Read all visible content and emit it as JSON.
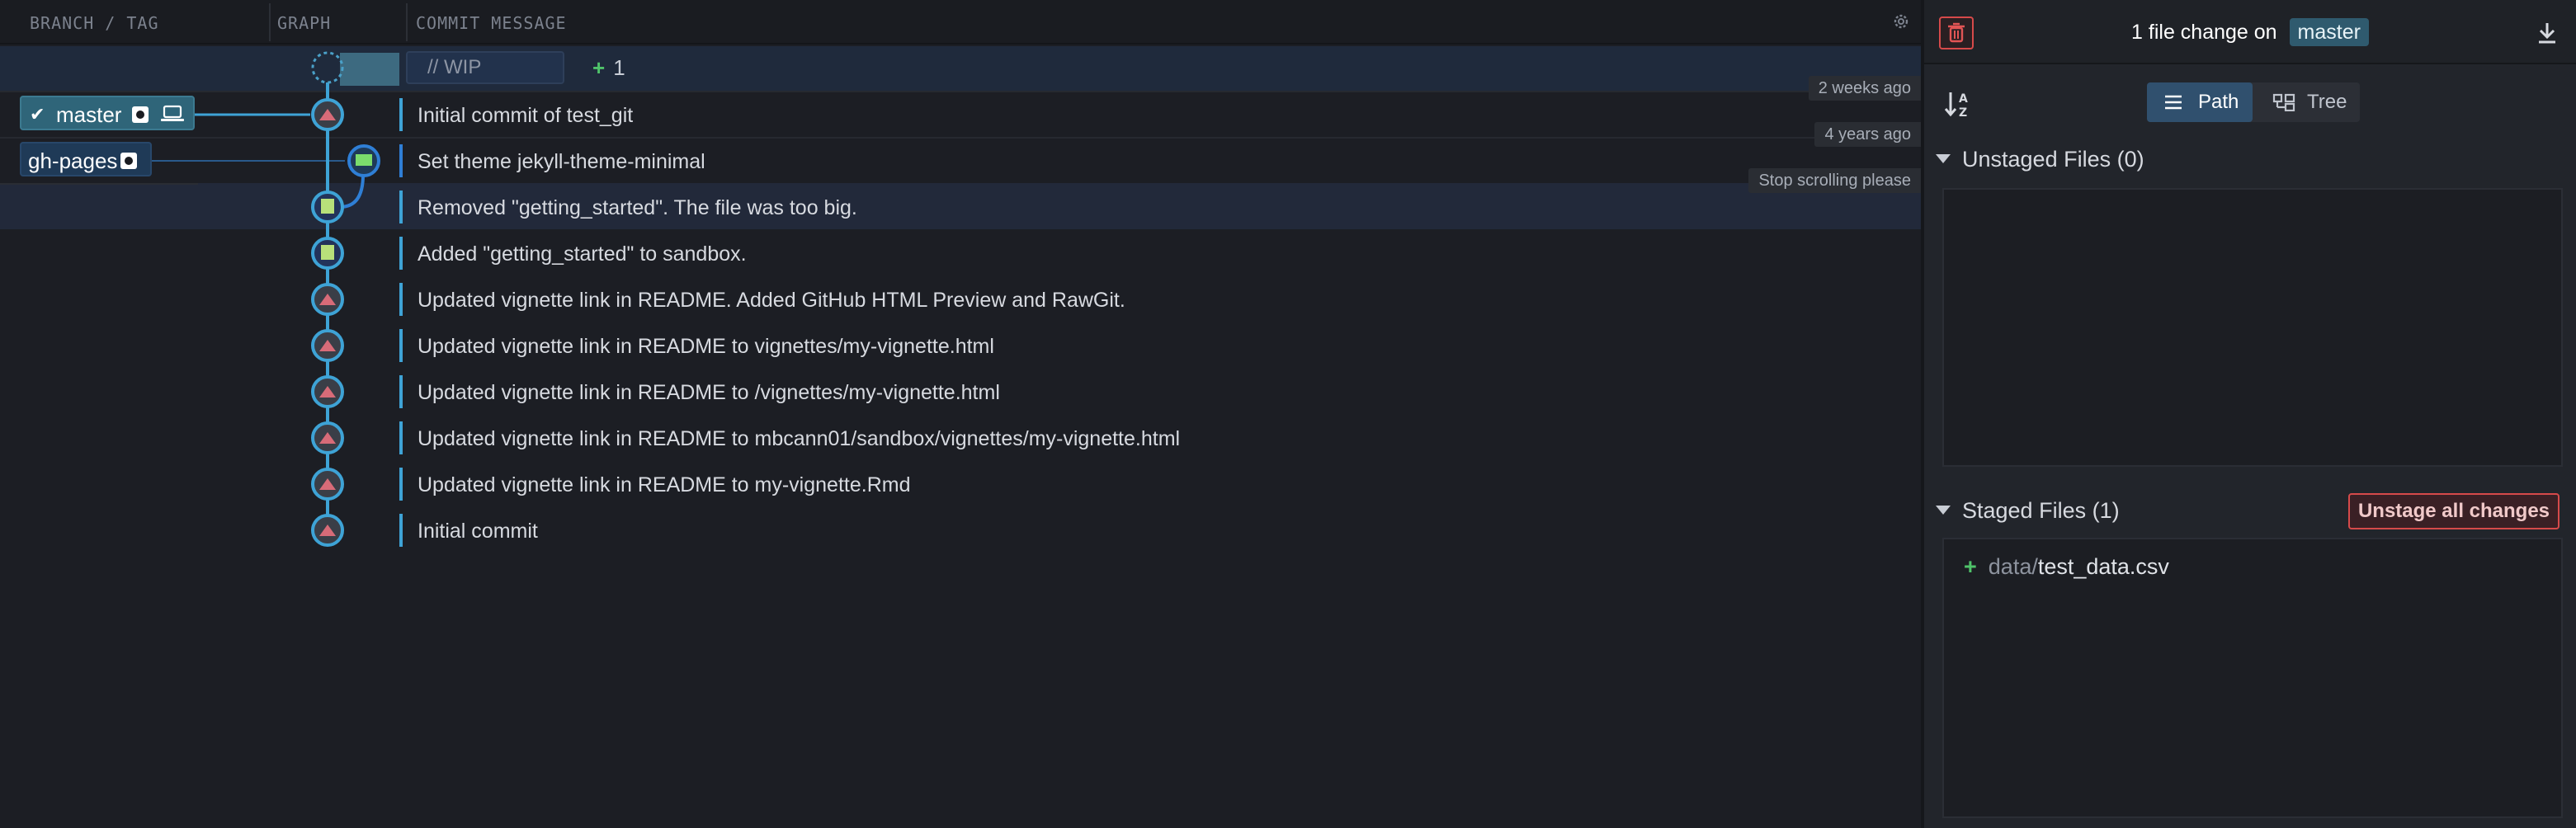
{
  "graph": {
    "column_headers": {
      "branch_tag": "BRANCH / TAG",
      "graph": "GRAPH",
      "commit_message": "COMMIT MESSAGE"
    },
    "wip": {
      "label": "// WIP",
      "plus_count": "1",
      "plus_sign": "+"
    },
    "branches": [
      {
        "name": "master",
        "checked": true,
        "color": "#2f6579"
      },
      {
        "name": "gh-pages",
        "checked": false,
        "color": "#1f3a57"
      }
    ],
    "timestamps": {
      "first": "2 weeks ago",
      "second": "4 years ago",
      "third": "Stop scrolling please"
    },
    "commits": [
      {
        "message": "Initial commit of test_git"
      },
      {
        "message": "Set theme jekyll-theme-minimal"
      },
      {
        "message": "Removed \"getting_started\". The file was too big."
      },
      {
        "message": "Added \"getting_started\" to sandbox."
      },
      {
        "message": "Updated vignette link in README. Added GitHub HTML Preview and RawGit."
      },
      {
        "message": "Updated vignette link in README to vignettes/my-vignette.html"
      },
      {
        "message": "Updated vignette link in README to /vignettes/my-vignette.html"
      },
      {
        "message": "Updated vignette link in README to mbcann01/sandbox/vignettes/my-vignette.html"
      },
      {
        "message": "Updated vignette link in README to my-vignette.Rmd"
      },
      {
        "message": "Initial commit"
      }
    ]
  },
  "panel": {
    "header": {
      "prefix": "1 file change on",
      "branch": "master"
    },
    "view_toggle": {
      "path_label": "Path",
      "tree_label": "Tree"
    },
    "unstaged": {
      "title": "Unstaged Files (0)"
    },
    "staged": {
      "title": "Staged Files (1)",
      "unstage_all_label": "Unstage all changes",
      "files": [
        {
          "dir": "data/",
          "name": "test_data.csv",
          "status": "+"
        }
      ]
    }
  },
  "colors": {
    "accent_teal": "#2f6579",
    "added_green": "#4fc36a",
    "danger_red": "#d64a4a",
    "line_blue": "#3ea3d6"
  }
}
